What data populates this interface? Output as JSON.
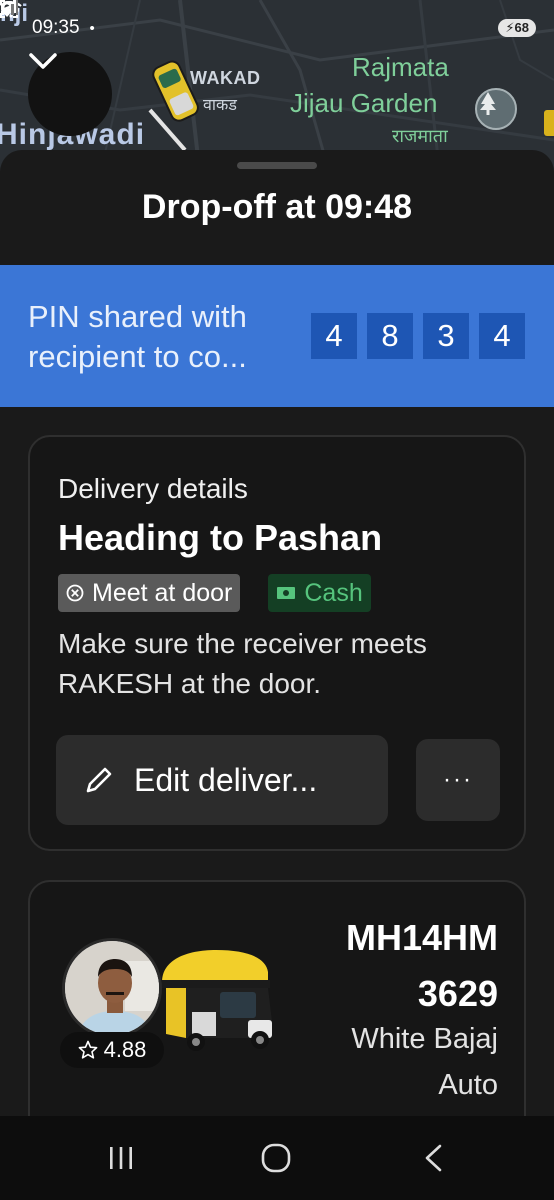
{
  "status_bar": {
    "time": "09:35",
    "battery": "68"
  },
  "map": {
    "labels": {
      "nji": "nji",
      "wakad": "WAKAD",
      "wakad_mr": "वाकड",
      "rajmata": "Rajmata",
      "jijau": "Jijau Garden",
      "rajmata_mr": "राजमाता",
      "hinjawadi": "Hinjawadi"
    },
    "icons": [
      "chevron-down-icon",
      "auto-rickshaw-icon",
      "tree-pin-icon"
    ]
  },
  "sheet": {
    "title": "Drop-off at 09:48",
    "pin": {
      "text": "PIN shared with recipient to co...",
      "digits": [
        "4",
        "8",
        "3",
        "4"
      ]
    },
    "delivery": {
      "label": "Delivery details",
      "heading": "Heading to Pashan",
      "tags": {
        "door": "Meet at door",
        "cash": "Cash"
      },
      "note": "Make sure the receiver meets RAKESH at the door.",
      "edit_label": "Edit deliver...",
      "more_label": "···"
    },
    "driver": {
      "rating": "4.88",
      "plate_line1": "MH14HM",
      "plate_line2": "3629",
      "vehicle": "White Bajaj Auto"
    }
  },
  "colors": {
    "pin_band": "#3b76d6",
    "pin_digit_bg": "#1e56b4",
    "cash_tag_text": "#56c47d",
    "map_park_label": "#7fcf9a"
  }
}
